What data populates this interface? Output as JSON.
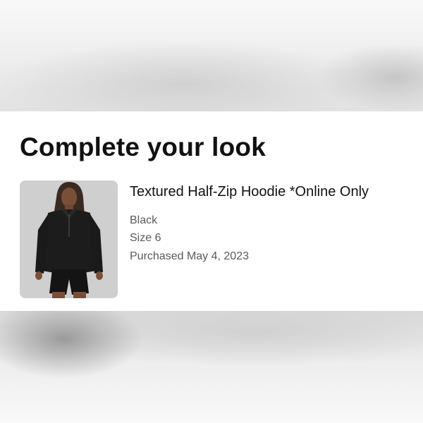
{
  "heading": "Complete your look",
  "product": {
    "name": "Textured Half-Zip Hoodie *Online Only",
    "color": "Black",
    "size": "Size 6",
    "purchased": "Purchased May 4, 2023"
  },
  "colors": {
    "heading_text": "#111111",
    "meta_text": "#5a5a5a",
    "card_background": "#ffffff",
    "image_background": "#cfcfcf"
  }
}
